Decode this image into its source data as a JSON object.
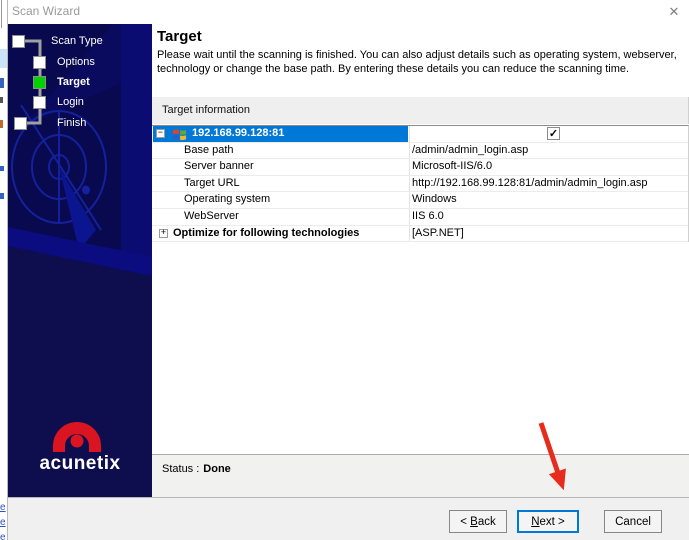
{
  "window": {
    "title": "Scan Wizard",
    "close_glyph": "✕"
  },
  "desktop": {
    "edge_letters": [
      "e",
      "e",
      "e"
    ]
  },
  "sidebar": {
    "steps": [
      {
        "label": "Scan Type",
        "state": "done"
      },
      {
        "label": "Options",
        "state": "todo"
      },
      {
        "label": "Target",
        "state": "active"
      },
      {
        "label": "Login",
        "state": "todo"
      },
      {
        "label": "Finish",
        "state": "todo"
      }
    ],
    "logo_text": "acunetix"
  },
  "header": {
    "title": "Target",
    "description": "Please wait until the scanning is finished. You can also adjust details such as operating system, webserver, technology or change the base path. By entering these details you can reduce the scanning time."
  },
  "section": {
    "title": "Target information"
  },
  "table": {
    "host": {
      "expand_glyph": "−",
      "icon": "windows-logo",
      "address": "192.168.99.128:81",
      "checked": true,
      "check_glyph": "✓"
    },
    "rows": [
      {
        "label": "Base path",
        "value": "/admin/admin_login.asp"
      },
      {
        "label": "Server banner",
        "value": "Microsoft-IIS/6.0"
      },
      {
        "label": "Target URL",
        "value": "http://192.168.99.128:81/admin/admin_login.asp"
      },
      {
        "label": "Operating system",
        "value": "Windows"
      },
      {
        "label": "WebServer",
        "value": "IIS 6.0"
      }
    ],
    "optimize": {
      "expand_glyph": "+",
      "label": "Optimize for following technologies",
      "value": "[ASP.NET]"
    }
  },
  "status": {
    "label": "Status :",
    "value": "Done"
  },
  "buttons": {
    "back": {
      "pre": "< ",
      "mnemonic": "B",
      "post": "ack"
    },
    "next": {
      "pre": "",
      "mnemonic": "N",
      "post": "ext >"
    },
    "cancel": {
      "label": "Cancel"
    }
  },
  "annotation": {
    "type": "arrow",
    "points_to": "next-button",
    "color": "#e72b1c"
  },
  "colors": {
    "selection": "#0078d7",
    "active_step_green": "#00d200",
    "logo_red": "#da1420",
    "sidebar_navy": "#08094e"
  }
}
